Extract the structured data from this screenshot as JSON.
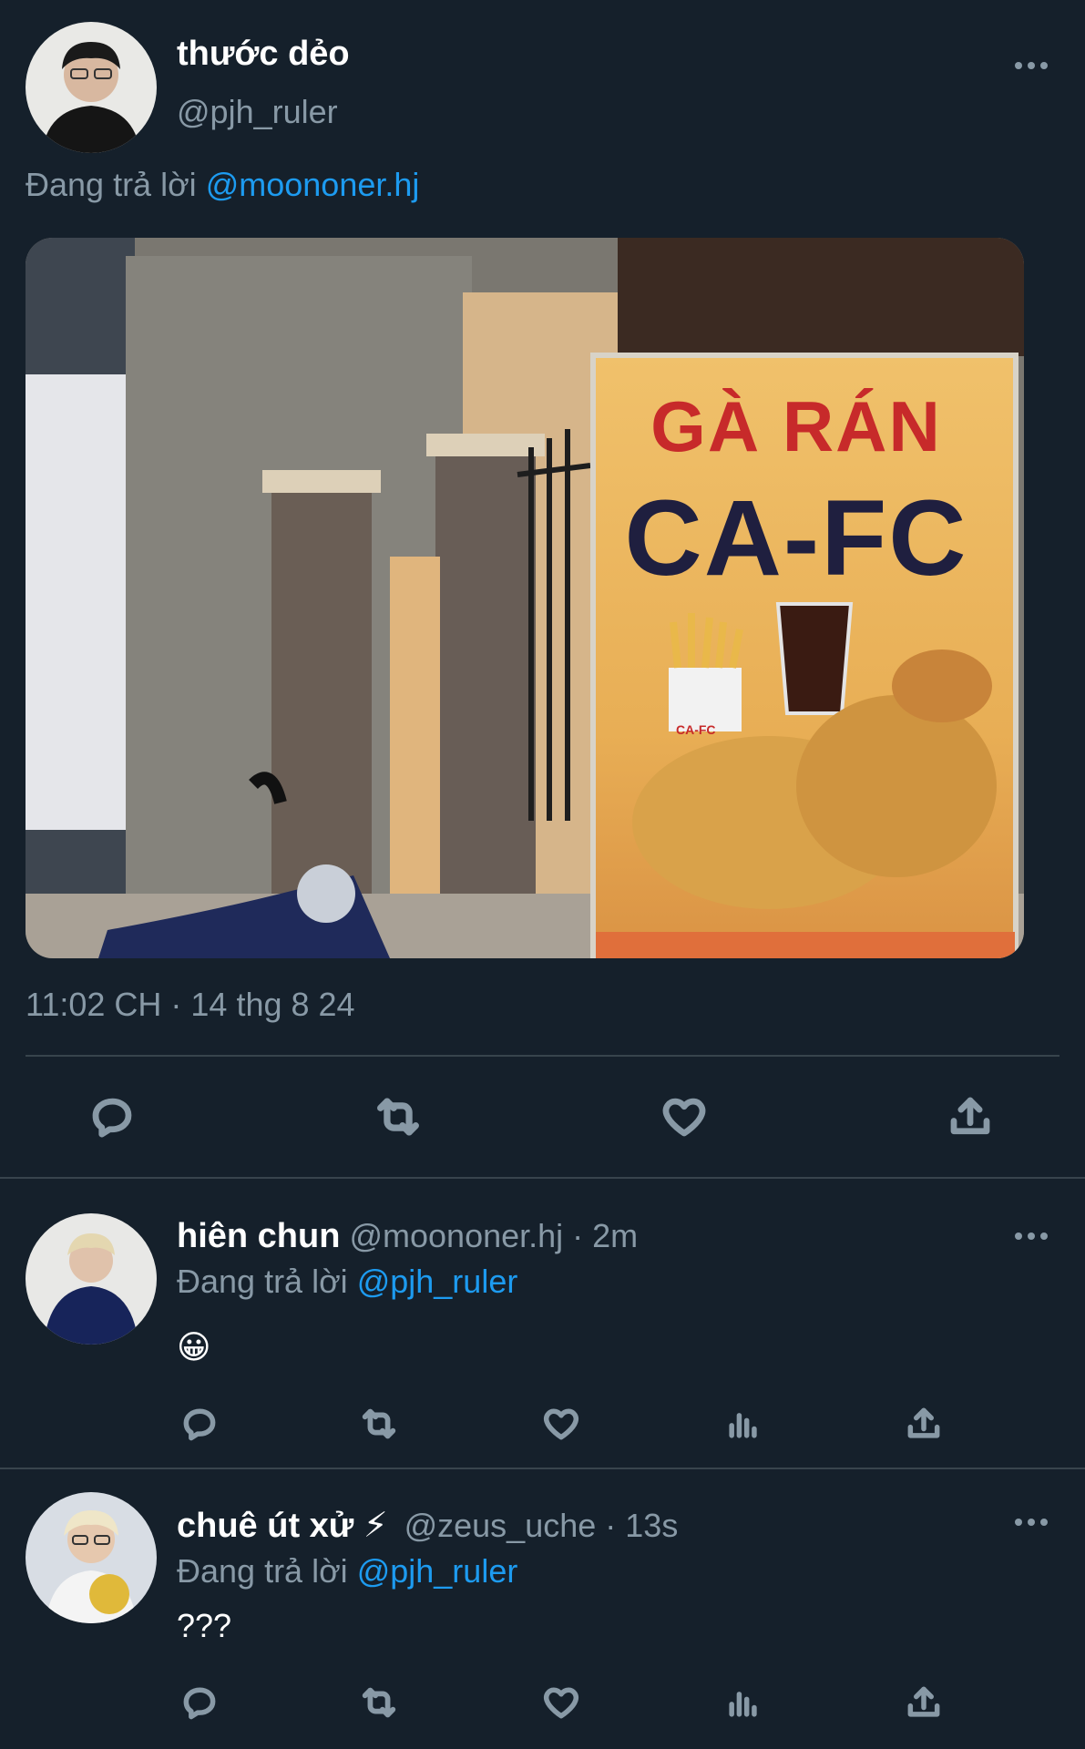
{
  "tweet": {
    "display_name": "thước dẻo",
    "handle": "@pjh_ruler",
    "replying_prefix": "Đang trả lời",
    "replying_to": "@moononer.hj",
    "photo_sign": {
      "line1": "GÀ RÁN",
      "line2": "CA-FC",
      "cup_label": "CA-FC"
    },
    "timestamp": "11:02 CH · 14 thg 8 24"
  },
  "replies": [
    {
      "display_name": "hiên chun",
      "handle": "@moononer.hj",
      "time": "· 2m",
      "replying_prefix": "Đang trả lời",
      "replying_to": "@pjh_ruler",
      "body": "😀"
    },
    {
      "display_name": "chuê út xử ⚡",
      "handle": "@zeus_uche",
      "time": "· 13s",
      "replying_prefix": "Đang trả lời",
      "replying_to": "@pjh_ruler",
      "body": "???"
    }
  ],
  "icons": {
    "more": "more-horizontal-icon",
    "reply": "reply-icon",
    "retweet": "retweet-icon",
    "like": "like-icon",
    "views": "views-icon",
    "share": "share-icon"
  },
  "colors": {
    "background": "#15202b",
    "text": "#ffffff",
    "muted": "#8899a6",
    "link": "#1d9bf0",
    "divider": "#38444d"
  }
}
